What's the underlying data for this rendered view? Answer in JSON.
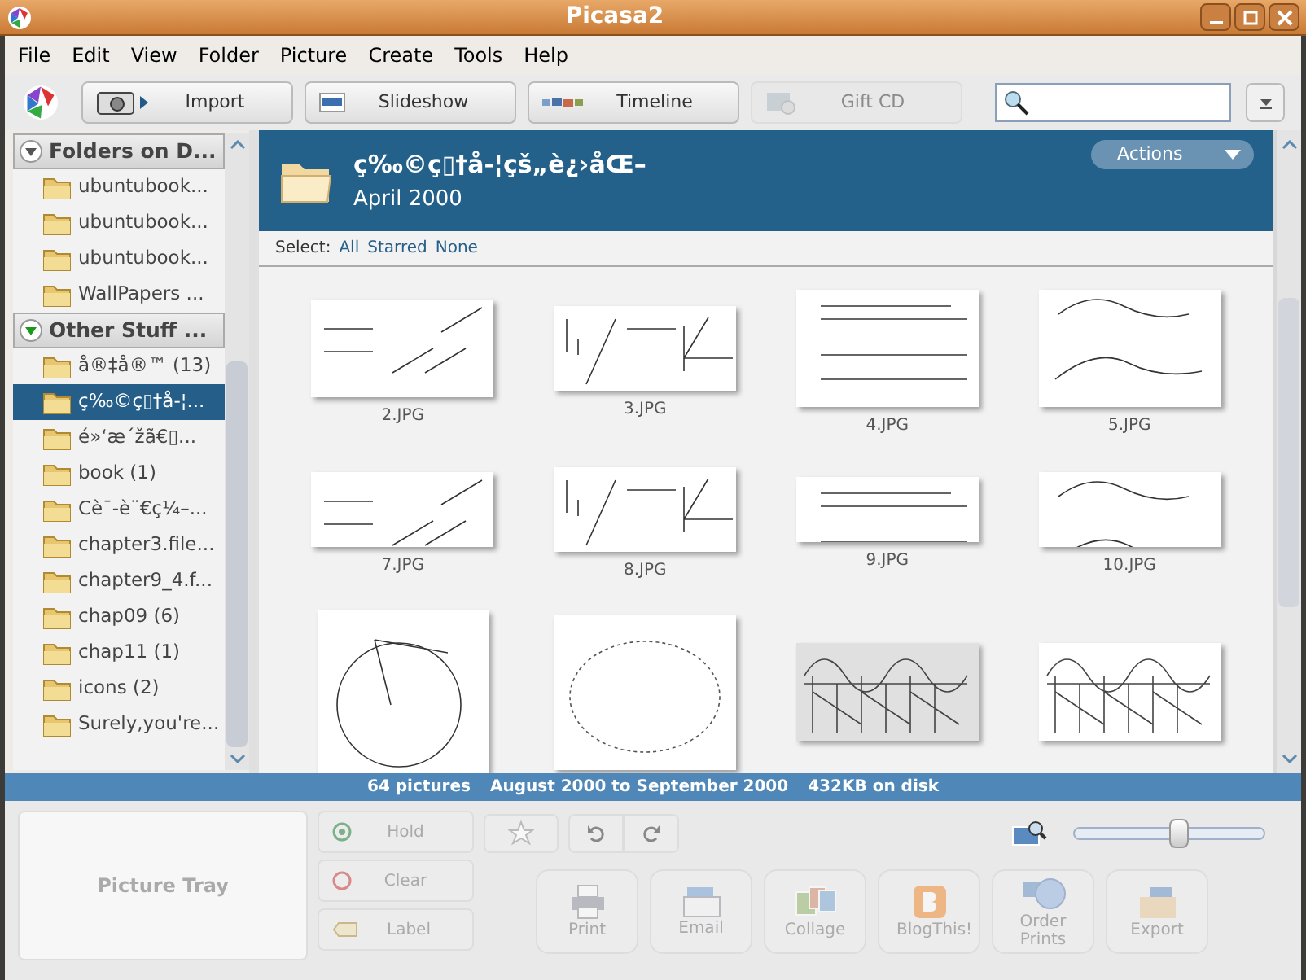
{
  "window": {
    "title": "Picasa2"
  },
  "menu": [
    "File",
    "Edit",
    "View",
    "Folder",
    "Picture",
    "Create",
    "Tools",
    "Help"
  ],
  "toolbar": [
    {
      "label": "Import",
      "kind": "camera",
      "disabled": false
    },
    {
      "label": "Slideshow",
      "kind": "screen",
      "disabled": false
    },
    {
      "label": "Timeline",
      "kind": "strip",
      "disabled": false
    },
    {
      "label": "Gift CD",
      "kind": "disc",
      "disabled": true
    }
  ],
  "sidebar": {
    "groups": [
      {
        "title": "Folders on D...",
        "expanded": true,
        "items": [
          {
            "label": "ubuntubook...",
            "selected": false
          },
          {
            "label": "ubuntubook...",
            "selected": false
          },
          {
            "label": "ubuntubook...",
            "selected": false
          },
          {
            "label": "WallPapers ...",
            "selected": false
          }
        ]
      },
      {
        "title": "Other Stuff ...",
        "expanded": true,
        "items": [
          {
            "label": "å®‡å®™ (13)",
            "selected": false
          },
          {
            "label": "ç‰©ç▯†å-¦...",
            "selected": true
          },
          {
            "label": "é»‘æ´žã€▯...",
            "selected": false
          },
          {
            "label": "book (1)",
            "selected": false
          },
          {
            "label": "Cè¯-è¨€ç¼–...",
            "selected": false
          },
          {
            "label": "chapter3.file...",
            "selected": false
          },
          {
            "label": "chapter9_4.f...",
            "selected": false
          },
          {
            "label": "chap09 (6)",
            "selected": false
          },
          {
            "label": "chap11 (1)",
            "selected": false
          },
          {
            "label": "icons (2)",
            "selected": false
          },
          {
            "label": "Surely,you're...",
            "selected": false
          }
        ]
      }
    ]
  },
  "folder": {
    "title": "ç‰©ç▯†å-¦çš„è¿›åŒ–",
    "date": "April 2000",
    "actions": "Actions",
    "select_label": "Select:",
    "select_links": [
      "All",
      "Starred",
      "None"
    ]
  },
  "thumbnails": [
    {
      "kind": "captioned",
      "caption": "2.JPG"
    },
    {
      "kind": "captioned",
      "caption": "3.JPG"
    },
    {
      "kind": "captioned",
      "caption": "4.JPG"
    },
    {
      "kind": "captioned",
      "caption": "5.JPG"
    },
    {
      "kind": "captioned",
      "caption": "7.JPG"
    },
    {
      "kind": "captioned",
      "caption": "8.JPG"
    },
    {
      "kind": "captioned",
      "caption": "9.JPG"
    },
    {
      "kind": "captioned",
      "caption": "10.JPG"
    },
    {
      "kind": "picture"
    },
    {
      "kind": "picture"
    },
    {
      "kind": "picture"
    },
    {
      "kind": "picture"
    }
  ],
  "status_bar": [
    "64 pictures",
    "August 2000 to September 2000",
    "432KB on disk"
  ],
  "tray": {
    "label": "Picture Tray",
    "buttons": [
      {
        "label": "Hold",
        "kind": "hold"
      },
      {
        "label": "Clear",
        "kind": "clear"
      },
      {
        "label": "Label",
        "kind": "label"
      }
    ]
  },
  "zoom": {
    "level": 0.55
  },
  "actions": [
    {
      "label": "Print",
      "kind": "print"
    },
    {
      "label": "Email",
      "kind": "email"
    },
    {
      "label": "Collage",
      "kind": "collage"
    },
    {
      "label": "BlogThis!",
      "kind": "blog"
    },
    {
      "label": "Order Prints",
      "kind": "order"
    },
    {
      "label": "Export",
      "kind": "export"
    }
  ]
}
